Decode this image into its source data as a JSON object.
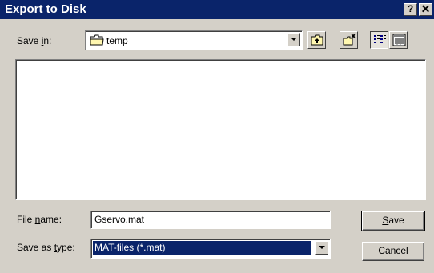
{
  "window": {
    "title": "Export to Disk",
    "help_glyph": "?",
    "close_glyph": "✕"
  },
  "save_in": {
    "label_pre": "Save ",
    "label_accel": "i",
    "label_post": "n:",
    "value": "temp",
    "icon": "folder-icon"
  },
  "toolbar": {
    "buttons": [
      {
        "name": "up-one-level-button",
        "icon": "up-folder-icon"
      },
      {
        "name": "create-new-folder-button",
        "icon": "new-folder-icon"
      },
      {
        "name": "list-view-button",
        "icon": "list-view-icon",
        "pressed": true
      },
      {
        "name": "details-view-button",
        "icon": "details-view-icon",
        "pressed": false
      }
    ]
  },
  "file_name": {
    "label_pre": "File ",
    "label_accel": "n",
    "label_post": "ame:",
    "value": "Gservo.mat"
  },
  "save_as_type": {
    "label_pre": "Save as ",
    "label_accel": "t",
    "label_post": "ype:",
    "value": "MAT-files (*.mat)"
  },
  "buttons": {
    "save_accel": "S",
    "save_rest": "ave",
    "cancel": "Cancel"
  }
}
